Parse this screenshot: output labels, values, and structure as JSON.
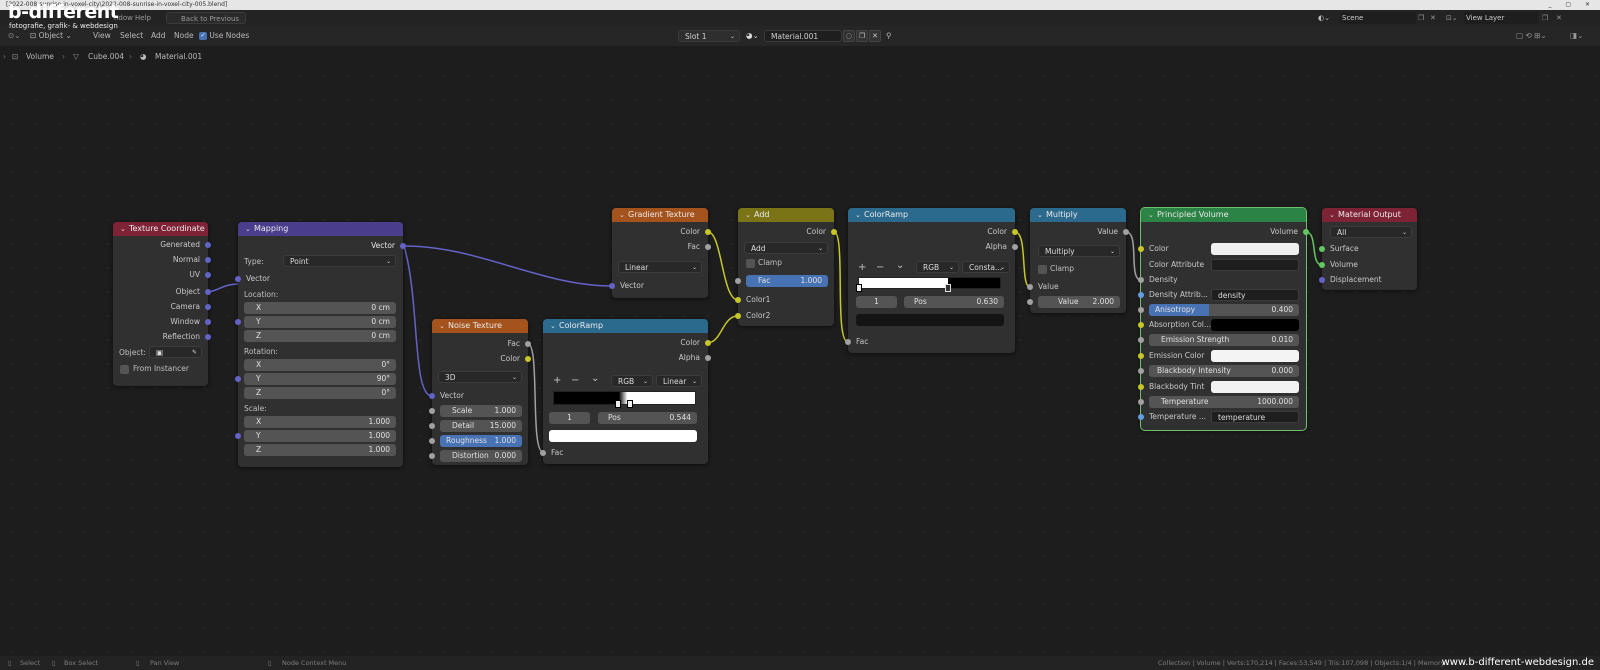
{
  "window": {
    "title": "[2022-008-sunrise-in-voxel-city\\2022-008-sunrise-in-voxel-city-005.blend]",
    "controls": "_ ▢ ✕"
  },
  "logo": {
    "name": "b-different",
    "tagline": "fotografie, grafik- & webdesign"
  },
  "topbar": {
    "menu_window": "ndow",
    "menu_help": "Help",
    "back_button": "Back to Previous",
    "scene_label": "Scene",
    "view_layer_label": "View Layer"
  },
  "header": {
    "object_mode": "Object",
    "menu": [
      "View",
      "Select",
      "Add",
      "Node"
    ],
    "use_nodes_label": "Use Nodes",
    "slot": "Slot 1",
    "material": "Material.001"
  },
  "breadcrumb": [
    "Volume",
    "Cube.004",
    "Material.001"
  ],
  "nodes": {
    "texcoord": {
      "title": "Texture Coordinate",
      "outputs": [
        "Generated",
        "Normal",
        "UV",
        "Object",
        "Camera",
        "Window",
        "Reflection"
      ],
      "object_label": "Object:",
      "from_instancer": "From Instancer"
    },
    "mapping": {
      "title": "Mapping",
      "output": "Vector",
      "type_label": "Type:",
      "type_value": "Point",
      "vector_label": "Vector",
      "location_label": "Location:",
      "location": [
        {
          "a": "X",
          "v": "0 cm"
        },
        {
          "a": "Y",
          "v": "0 cm"
        },
        {
          "a": "Z",
          "v": "0 cm"
        }
      ],
      "rotation_label": "Rotation:",
      "rotation": [
        {
          "a": "X",
          "v": "0°"
        },
        {
          "a": "Y",
          "v": "90°"
        },
        {
          "a": "Z",
          "v": "0°"
        }
      ],
      "scale_label": "Scale:",
      "scale": [
        {
          "a": "X",
          "v": "1.000"
        },
        {
          "a": "Y",
          "v": "1.000"
        },
        {
          "a": "Z",
          "v": "1.000"
        }
      ]
    },
    "noise": {
      "title": "Noise Texture",
      "outputs": [
        "Fac",
        "Color"
      ],
      "dimensions": "3D",
      "vector_label": "Vector",
      "scale": {
        "label": "Scale",
        "value": "1.000"
      },
      "detail": {
        "label": "Detail",
        "value": "15.000"
      },
      "roughness": {
        "label": "Roughness",
        "value": "1.000"
      },
      "distortion": {
        "label": "Distortion",
        "value": "0.000"
      }
    },
    "ramp1": {
      "title": "ColorRamp",
      "outputs": [
        "Color",
        "Alpha"
      ],
      "plus": "+",
      "minus": "−",
      "down": "⌄",
      "mode": "RGB",
      "interp": "Linear",
      "index": "1",
      "pos_label": "Pos",
      "pos": "0.544",
      "fac_label": "Fac",
      "stop_pos": 0.46
    },
    "gradient": {
      "title": "Gradient Texture",
      "outputs": [
        "Color",
        "Fac"
      ],
      "type": "Linear",
      "vector_label": "Vector"
    },
    "add": {
      "title": "Add",
      "output": "Color",
      "blend": "Add",
      "clamp": "Clamp",
      "fac": {
        "label": "Fac",
        "value": "1.000"
      },
      "inputs": [
        "Color1",
        "Color2"
      ]
    },
    "ramp2": {
      "title": "ColorRamp",
      "outputs": [
        "Color",
        "Alpha"
      ],
      "plus": "+",
      "minus": "−",
      "down": "⌄",
      "mode": "RGB",
      "interp": "Consta...",
      "index": "1",
      "pos_label": "Pos",
      "pos": "0.630",
      "fac_label": "Fac",
      "stop_pos": 0.63
    },
    "multiply": {
      "title": "Multiply",
      "output": "Value",
      "op": "Multiply",
      "clamp": "Clamp",
      "input_label": "Value",
      "value": {
        "label": "Value",
        "value": "2.000"
      }
    },
    "volume": {
      "title": "Principled Volume",
      "output": "Volume",
      "color": "Color",
      "color_attr": "Color Attribute",
      "density": "Density",
      "density_attr": {
        "label": "Density Attrib...",
        "value": "density"
      },
      "anisotropy": {
        "label": "Anisotropy",
        "value": "0.400",
        "fill": 0.4
      },
      "absorption": "Absorption Col...",
      "emission_strength": {
        "label": "Emission Strength",
        "value": "0.010"
      },
      "emission_color": "Emission Color",
      "blackbody_intensity": {
        "label": "Blackbody Intensity",
        "value": "0.000"
      },
      "blackbody_tint": "Blackbody Tint",
      "temperature": {
        "label": "Temperature",
        "value": "1000.000"
      },
      "temperature_attr": {
        "label": "Temperature ...",
        "value": "temperature"
      }
    },
    "output": {
      "title": "Material Output",
      "target": "All",
      "inputs": [
        "Surface",
        "Volume",
        "Displacement"
      ]
    }
  },
  "status": {
    "select": "Select",
    "box_select": "Box Select",
    "pan_view": "Pan View",
    "context_menu": "Node Context Menu",
    "stats": "Collection | Volume | Verts:170,214 | Faces:53,549 | Tris:107,098 | Objects:1/4 | Memory..."
  },
  "watermark": "www.b-different-webdesign.de",
  "colors": {
    "vector_socket": "#6363c7",
    "float_socket": "#a1a1a1",
    "color_socket": "#c7c729",
    "shader_socket": "#63c763",
    "selected_field": "#4772b3"
  }
}
